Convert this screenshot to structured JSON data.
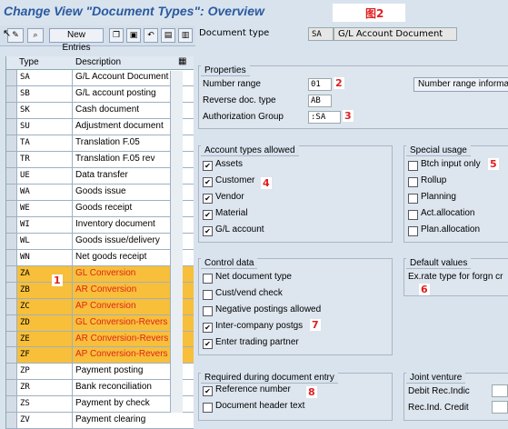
{
  "window": {
    "title": "Change View \"Document Types\": Overview",
    "figure_label": "图2"
  },
  "toolbar": {
    "new_entries_label": "New Entries"
  },
  "doctype": {
    "label": "Document type",
    "code": "SA",
    "name": "G/L Account Document"
  },
  "grid": {
    "headers": {
      "type": "Type",
      "description": "Description"
    },
    "rows": [
      {
        "type": "SA",
        "desc": "G/L Account Document"
      },
      {
        "type": "SB",
        "desc": "G/L account posting"
      },
      {
        "type": "SK",
        "desc": "Cash document"
      },
      {
        "type": "SU",
        "desc": "Adjustment document"
      },
      {
        "type": "TA",
        "desc": "Translation F.05"
      },
      {
        "type": "TR",
        "desc": "Translation F.05 rev"
      },
      {
        "type": "UE",
        "desc": "Data transfer"
      },
      {
        "type": "WA",
        "desc": "Goods issue"
      },
      {
        "type": "WE",
        "desc": "Goods receipt"
      },
      {
        "type": "WI",
        "desc": "Inventory document"
      },
      {
        "type": "WL",
        "desc": "Goods issue/delivery"
      },
      {
        "type": "WN",
        "desc": "Net goods receipt"
      },
      {
        "type": "ZA",
        "desc": "GL Conversion"
      },
      {
        "type": "ZB",
        "desc": "AR Conversion"
      },
      {
        "type": "ZC",
        "desc": "AP Conversion"
      },
      {
        "type": "ZD",
        "desc": "GL Conversion-Revers"
      },
      {
        "type": "ZE",
        "desc": "AR Conversion-Revers"
      },
      {
        "type": "ZF",
        "desc": "AP Conversion-Revers"
      },
      {
        "type": "ZP",
        "desc": "Payment posting"
      },
      {
        "type": "ZR",
        "desc": "Bank reconciliation"
      },
      {
        "type": "ZS",
        "desc": "Payment by check"
      },
      {
        "type": "ZV",
        "desc": "Payment clearing"
      }
    ],
    "marker": "1"
  },
  "properties": {
    "title": "Properties",
    "number_range_label": "Number range",
    "number_range_value": "01",
    "number_range_button": "Number range information",
    "reverse_label": "Reverse doc. type",
    "reverse_value": "AB",
    "auth_label": "Authorization Group",
    "auth_value": ":SA",
    "marker_2": "2",
    "marker_3": "3"
  },
  "account_types": {
    "title": "Account types allowed",
    "items": [
      "Assets",
      "Customer",
      "Vendor",
      "Material",
      "G/L account"
    ],
    "marker": "4"
  },
  "special_usage": {
    "title": "Special usage",
    "items": [
      "Btch input only",
      "Rollup",
      "Planning",
      "Act.allocation",
      "Plan.allocation"
    ],
    "marker": "5"
  },
  "control_data": {
    "title": "Control data",
    "items": [
      "Net document type",
      "Cust/vend check",
      "Negative postings allowed",
      "Inter-company postgs",
      "Enter trading partner"
    ],
    "marker": "7"
  },
  "default_values": {
    "title": "Default values",
    "exrate_label": "Ex.rate type for forgn cr",
    "marker": "6"
  },
  "required": {
    "title": "Required during document entry",
    "items": [
      "Reference number",
      "Document header text"
    ],
    "marker": "8"
  },
  "joint_venture": {
    "title": "Joint venture",
    "debit_label": "Debit Rec.Indic",
    "credit_label": "Rec.Ind. Credit"
  }
}
